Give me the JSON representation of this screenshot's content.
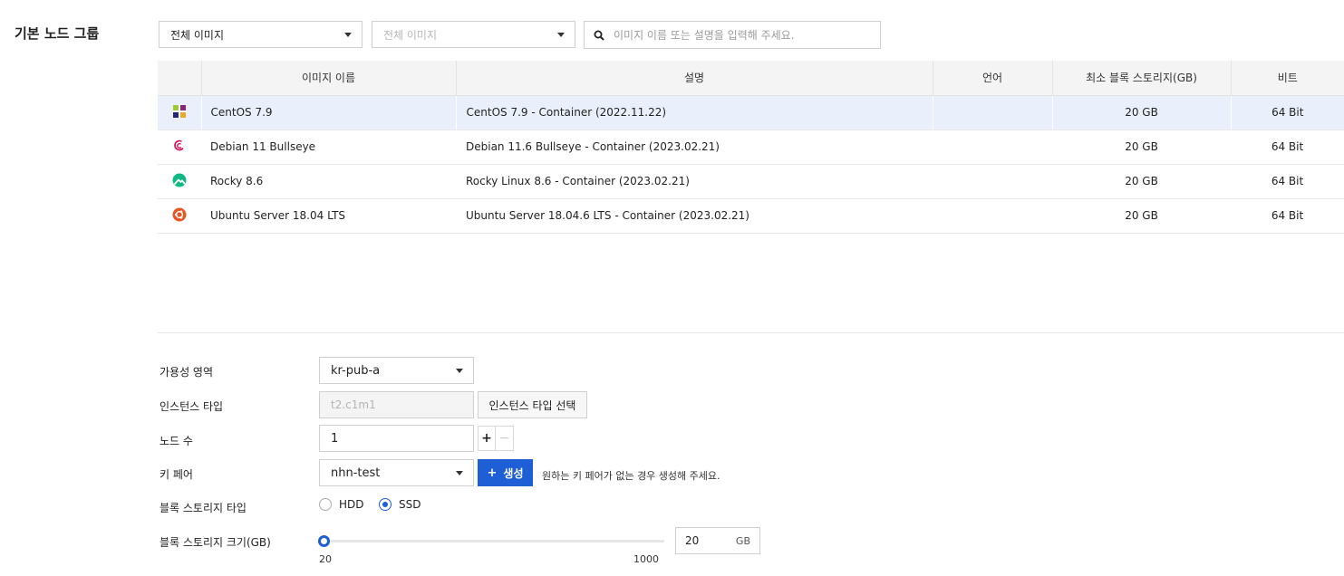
{
  "section_title": "기본 노드 그룹",
  "filters": {
    "image_scope": "전체 이미지",
    "image_type_placeholder": "전체 이미지",
    "search_placeholder": "이미지 이름 또는 설명을 입력해 주세요."
  },
  "table": {
    "headers": [
      "",
      "이미지 이름",
      "설명",
      "언어",
      "최소 블록 스토리지(GB)",
      "비트"
    ],
    "rows": [
      {
        "icon": "centos-icon",
        "name": "CentOS 7.9",
        "description": "CentOS 7.9 - Container (2022.11.22)",
        "language": "",
        "min_storage": "20 GB",
        "bits": "64 Bit",
        "selected": true
      },
      {
        "icon": "debian-icon",
        "name": "Debian 11 Bullseye",
        "description": "Debian 11.6 Bullseye - Container (2023.02.21)",
        "language": "",
        "min_storage": "20 GB",
        "bits": "64 Bit",
        "selected": false
      },
      {
        "icon": "rocky-icon",
        "name": "Rocky 8.6",
        "description": "Rocky Linux 8.6 - Container (2023.02.21)",
        "language": "",
        "min_storage": "20 GB",
        "bits": "64 Bit",
        "selected": false
      },
      {
        "icon": "ubuntu-icon",
        "name": "Ubuntu Server 18.04 LTS",
        "description": "Ubuntu Server 18.04.6 LTS - Container (2023.02.21)",
        "language": "",
        "min_storage": "20 GB",
        "bits": "64 Bit",
        "selected": false
      }
    ]
  },
  "form": {
    "availability_zone": {
      "label": "가용성 영역",
      "value": "kr-pub-a"
    },
    "instance_type": {
      "label": "인스턴스 타입",
      "value": "t2.c1m1",
      "button": "인스턴스 타입 선택"
    },
    "node_count": {
      "label": "노드 수",
      "value": "1",
      "plus": "+",
      "minus": "−"
    },
    "key_pair": {
      "label": "키 페어",
      "value": "nhn-test",
      "button_icon": "+",
      "button": "생성",
      "hint": "원하는 키 페어가 없는 경우 생성해 주세요."
    },
    "storage_type": {
      "label": "블록 스토리지 타입",
      "options": [
        "HDD",
        "SSD"
      ],
      "selected": "SSD"
    },
    "storage_size": {
      "label": "블록 스토리지 크기(GB)",
      "min": "20",
      "max": "1000",
      "value": "20",
      "unit": "GB"
    }
  },
  "colors": {
    "accent": "#1f5fd6",
    "selected_row": "#e9f0fb"
  }
}
